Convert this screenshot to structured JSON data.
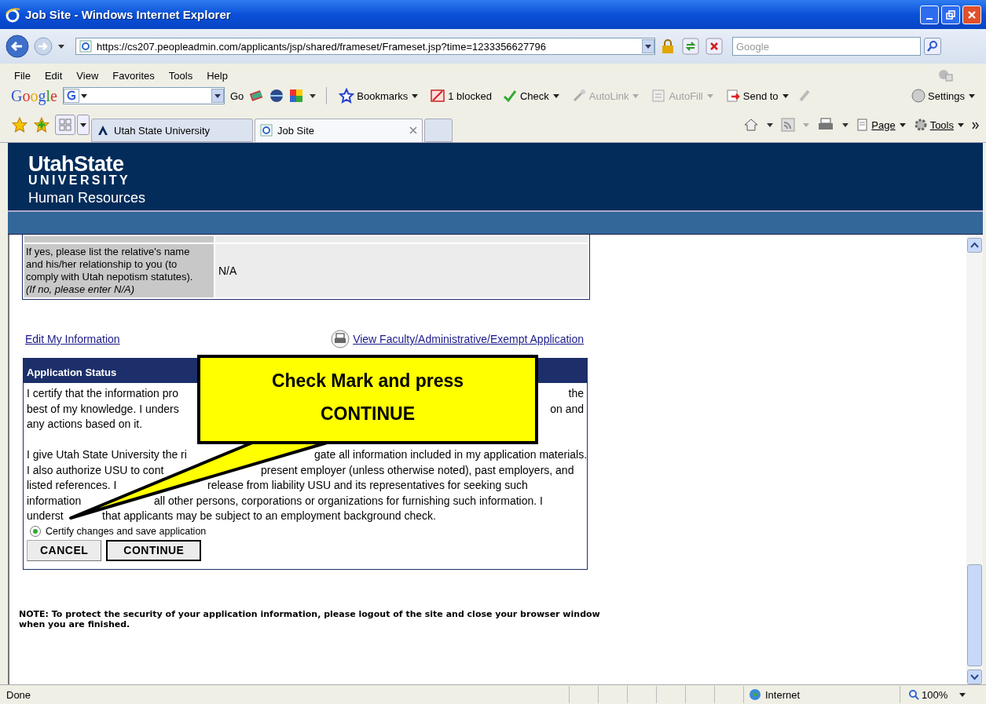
{
  "window": {
    "title": "Job Site - Windows Internet Explorer"
  },
  "address_bar": {
    "url": "https://cs207.peopleadmin.com/applicants/jsp/shared/frameset/Frameset.jsp?time=1233356627796"
  },
  "search": {
    "placeholder": "Google"
  },
  "menu": [
    "File",
    "Edit",
    "View",
    "Favorites",
    "Tools",
    "Help"
  ],
  "google_toolbar": {
    "logo": "Google",
    "go": "Go",
    "items": [
      {
        "kind": "star",
        "label": "Bookmarks",
        "disabled": false
      },
      {
        "kind": "blocked",
        "label": "1 blocked",
        "disabled": false
      },
      {
        "kind": "check",
        "label": "Check",
        "disabled": false
      },
      {
        "kind": "wand",
        "label": "AutoLink",
        "disabled": true
      },
      {
        "kind": "form",
        "label": "AutoFill",
        "disabled": true
      },
      {
        "kind": "send",
        "label": "Send to",
        "disabled": false
      }
    ],
    "settings": "Settings"
  },
  "tabs": [
    {
      "label": "Utah State University",
      "selected": false
    },
    {
      "label": "Job Site",
      "selected": true
    }
  ],
  "command_bar": [
    "Page",
    "Tools"
  ],
  "site_header": {
    "logo_top": "UtahState",
    "logo_bottom": "UNIVERSITY",
    "subtitle": "Human Resources"
  },
  "relative_row": {
    "label": "If yes, please list the relative's name and his/her relationship to you (to comply with Utah nepotism statutes).",
    "note": "(If no, please enter N/A)",
    "value": "N/A"
  },
  "links": {
    "edit": "Edit My Information",
    "view": "View Faculty/Administrative/Exempt Application"
  },
  "application_status": {
    "title": "Application Status",
    "paragraphs": [
      [
        {
          "left": "I certify that the information pro",
          "right": "the"
        },
        {
          "left": "best of my knowledge. I unders",
          "right": "on and"
        },
        {
          "left": "any actions based on it."
        }
      ],
      [
        {
          "left": "I give Utah State University the ri",
          "right": "gate all information included in my application materials."
        },
        {
          "left": "I also authorize USU to cont",
          "right": "present employer (unless otherwise noted), past employers, and"
        },
        {
          "left": "listed references. I",
          "right": "release from liability USU and its representatives for seeking such"
        },
        {
          "left": "information",
          "right": "all other persons, corporations or organizations for furnishing such information. I"
        },
        {
          "left": "underst",
          "right": "that applicants may be subject to an employment background check."
        }
      ]
    ],
    "option": {
      "label": "Certify changes and save application",
      "selected": true
    },
    "buttons": [
      {
        "label": "CANCEL",
        "default": false
      },
      {
        "label": "CONTINUE",
        "default": true
      }
    ]
  },
  "note": "NOTE:  To protect the security of your application information, please logout of the site and close your browser window when you are finished.",
  "callout": [
    "Check Mark and press",
    "CONTINUE"
  ],
  "status_bar": {
    "status": "Done",
    "zone": "Internet",
    "zoom": "100%"
  }
}
